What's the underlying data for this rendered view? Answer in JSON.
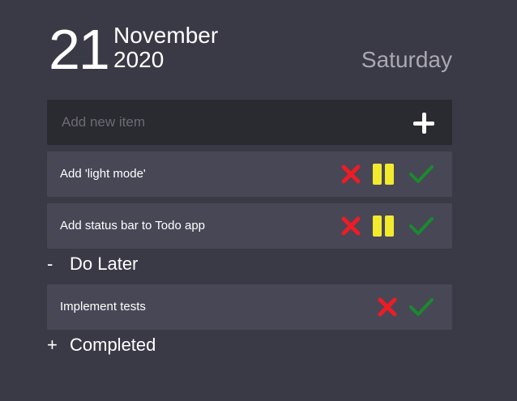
{
  "header": {
    "day": "21",
    "month": "November",
    "year": "2020",
    "weekday": "Saturday"
  },
  "add_item": {
    "placeholder": "Add new item",
    "icon": "plus-icon"
  },
  "active_items": [
    {
      "text": "Add 'light mode'",
      "actions": [
        "delete-icon",
        "pause-icon",
        "complete-icon"
      ]
    },
    {
      "text": "Add status bar to Todo app",
      "actions": [
        "delete-icon",
        "pause-icon",
        "complete-icon"
      ]
    }
  ],
  "sections": {
    "do_later": {
      "sign": "-",
      "label": "Do Later"
    },
    "completed": {
      "sign": "+",
      "label": "Completed"
    }
  },
  "do_later_items": [
    {
      "text": "Implement tests",
      "actions": [
        "delete-icon",
        "complete-icon"
      ]
    }
  ],
  "colors": {
    "background": "#3a3946",
    "input_background": "#2a2a31",
    "item_background": "#484756",
    "delete": "#ee1c25",
    "pause": "#f2ea2c",
    "complete": "#1a8a2e",
    "weekday_text": "#a9a8b0"
  }
}
